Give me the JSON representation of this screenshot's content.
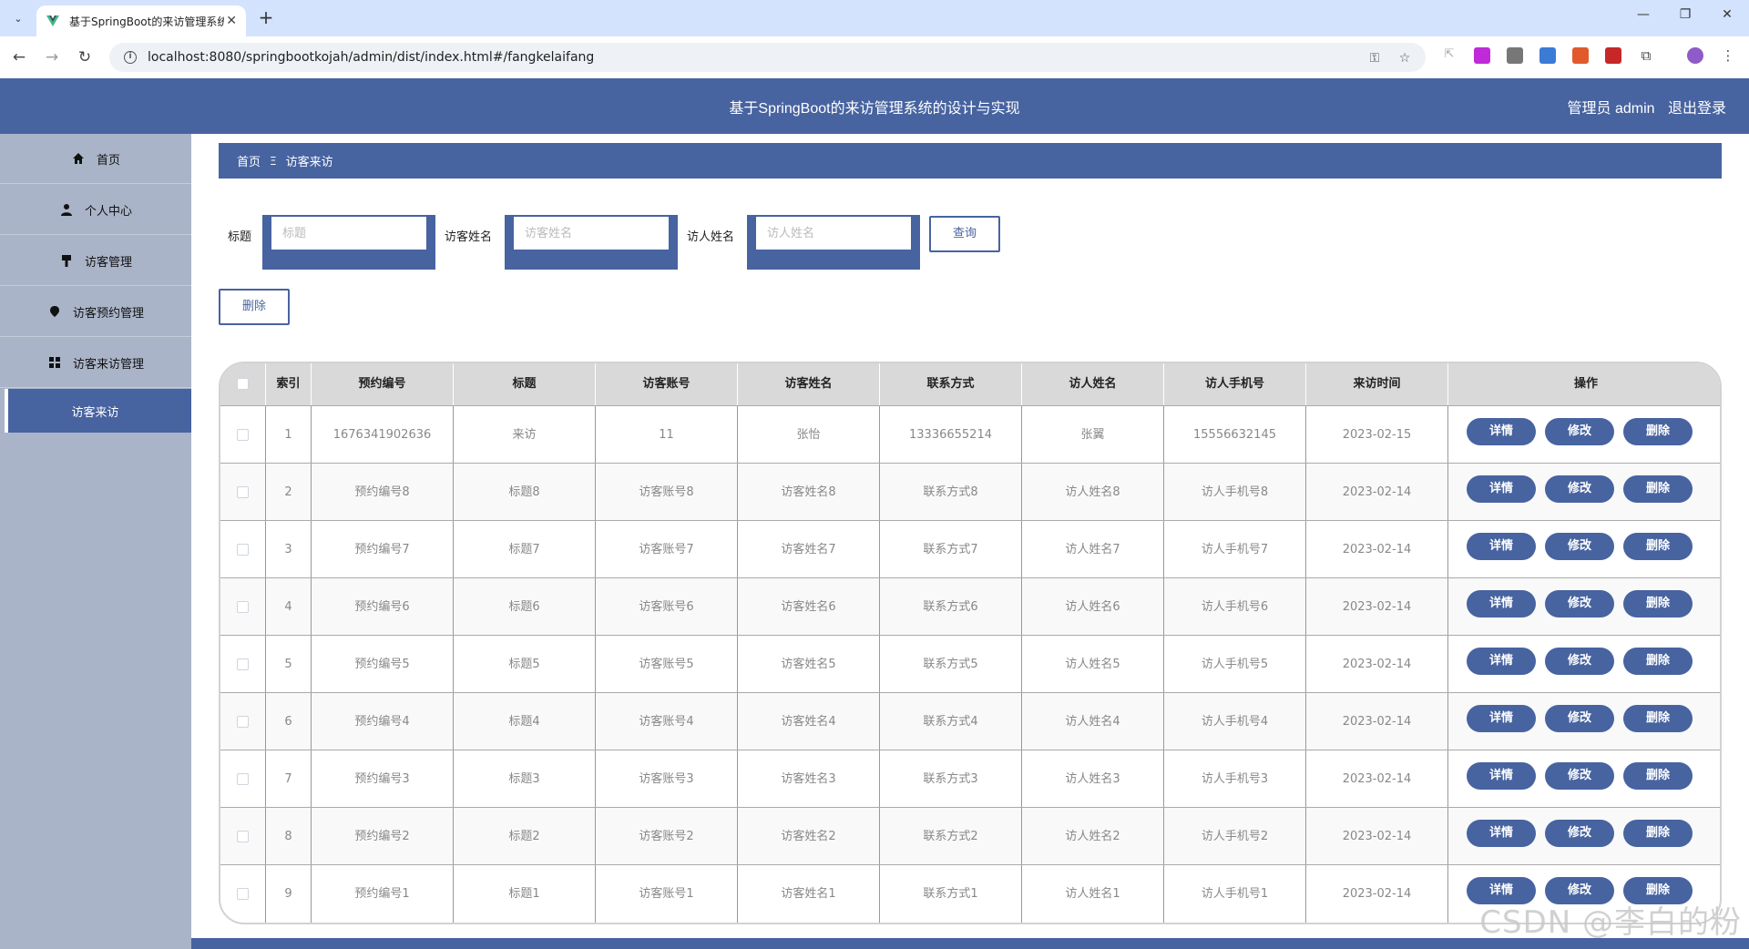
{
  "browser": {
    "tab_title": "基于SpringBoot的来访管理系统",
    "url": "localhost:8080/springbootkojah/admin/dist/index.html#/fangkelaifang"
  },
  "header": {
    "title": "基于SpringBoot的来访管理系统的设计与实现",
    "user": "管理员 admin",
    "logout": "退出登录"
  },
  "sidebar": {
    "items": [
      {
        "label": "首页",
        "icon": "home-icon"
      },
      {
        "label": "个人中心",
        "icon": "user-icon"
      },
      {
        "label": "访客管理",
        "icon": "hammer-icon"
      },
      {
        "label": "访客预约管理",
        "icon": "pin-icon"
      },
      {
        "label": "访客来访管理",
        "icon": "grid-icon"
      }
    ],
    "sub_active": "访客来访"
  },
  "breadcrumb": {
    "home": "首页",
    "sep": "Ξ",
    "current": "访客来访"
  },
  "search": {
    "title_label": "标题",
    "title_placeholder": "标题",
    "visitor_name_label": "访客姓名",
    "visitor_name_placeholder": "访客姓名",
    "host_name_label": "访人姓名",
    "host_name_placeholder": "访人姓名",
    "query_button": "查询"
  },
  "delete_button": "删除",
  "table": {
    "headers": [
      "索引",
      "预约编号",
      "标题",
      "访客账号",
      "访客姓名",
      "联系方式",
      "访人姓名",
      "访人手机号",
      "来访时间",
      "操作"
    ],
    "actions": [
      "详情",
      "修改",
      "删除"
    ],
    "rows": [
      [
        "1",
        "1676341902636",
        "来访",
        "11",
        "张怡",
        "13336655214",
        "张翼",
        "15556632145",
        "2023-02-15"
      ],
      [
        "2",
        "预约编号8",
        "标题8",
        "访客账号8",
        "访客姓名8",
        "联系方式8",
        "访人姓名8",
        "访人手机号8",
        "2023-02-14"
      ],
      [
        "3",
        "预约编号7",
        "标题7",
        "访客账号7",
        "访客姓名7",
        "联系方式7",
        "访人姓名7",
        "访人手机号7",
        "2023-02-14"
      ],
      [
        "4",
        "预约编号6",
        "标题6",
        "访客账号6",
        "访客姓名6",
        "联系方式6",
        "访人姓名6",
        "访人手机号6",
        "2023-02-14"
      ],
      [
        "5",
        "预约编号5",
        "标题5",
        "访客账号5",
        "访客姓名5",
        "联系方式5",
        "访人姓名5",
        "访人手机号5",
        "2023-02-14"
      ],
      [
        "6",
        "预约编号4",
        "标题4",
        "访客账号4",
        "访客姓名4",
        "联系方式4",
        "访人姓名4",
        "访人手机号4",
        "2023-02-14"
      ],
      [
        "7",
        "预约编号3",
        "标题3",
        "访客账号3",
        "访客姓名3",
        "联系方式3",
        "访人姓名3",
        "访人手机号3",
        "2023-02-14"
      ],
      [
        "8",
        "预约编号2",
        "标题2",
        "访客账号2",
        "访客姓名2",
        "联系方式2",
        "访人姓名2",
        "访人手机号2",
        "2023-02-14"
      ],
      [
        "9",
        "预约编号1",
        "标题1",
        "访客账号1",
        "访客姓名1",
        "联系方式1",
        "访人姓名1",
        "访人手机号1",
        "2023-02-14"
      ]
    ]
  },
  "watermark": "CSDN @李白的粉",
  "colors": {
    "primary": "#4763a0",
    "sidebar": "#aab4c8"
  }
}
